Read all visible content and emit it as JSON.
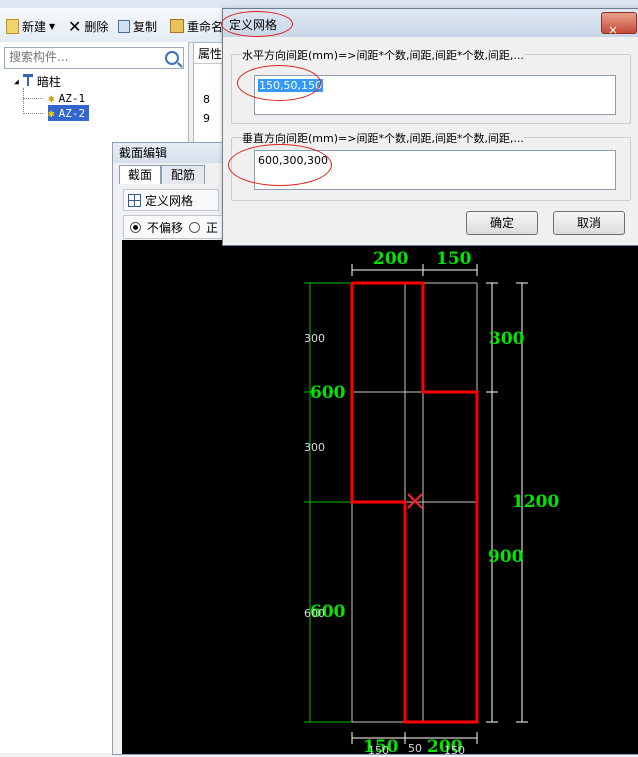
{
  "toolbar": {
    "new": "新建",
    "delete": "删除",
    "copy": "复制",
    "rename": "重命名"
  },
  "left": {
    "search_placeholder": "搜索构件...",
    "tree_root": "暗柱",
    "tree_items": [
      "AZ-1",
      "AZ-2"
    ]
  },
  "props": {
    "header": "属性",
    "rows": [
      "8",
      "9"
    ]
  },
  "section_editor": {
    "title": "截面编辑",
    "tabs": [
      "截面",
      "配筋"
    ],
    "define_grid": "定义网格",
    "no_offset": "不偏移",
    "other_option": "正"
  },
  "dialog": {
    "title": "定义网格",
    "h_label": "水平方向间距(mm)=>间距*个数,间距,间距*个数,间距,...",
    "h_value": "150,50,150",
    "v_label": "垂直方向间距(mm)=>间距*个数,间距,间距*个数,间距,...",
    "v_value": "600,300,300",
    "ok": "确定",
    "cancel": "取消",
    "close": "×"
  },
  "canvas": {
    "dims_top": [
      "200",
      "150"
    ],
    "dims_right": [
      "300",
      "1200",
      "900"
    ],
    "dims_left_big": [
      "600",
      "600"
    ],
    "dims_left_small": [
      "300",
      "300",
      "600"
    ],
    "dims_bottom": [
      "150",
      "50",
      "200",
      "150",
      "150"
    ]
  },
  "colors": {
    "outline": "#ff0000",
    "dim_green": "#00e600",
    "grid": "#c8c8c8",
    "canvas_bg": "#000000"
  }
}
